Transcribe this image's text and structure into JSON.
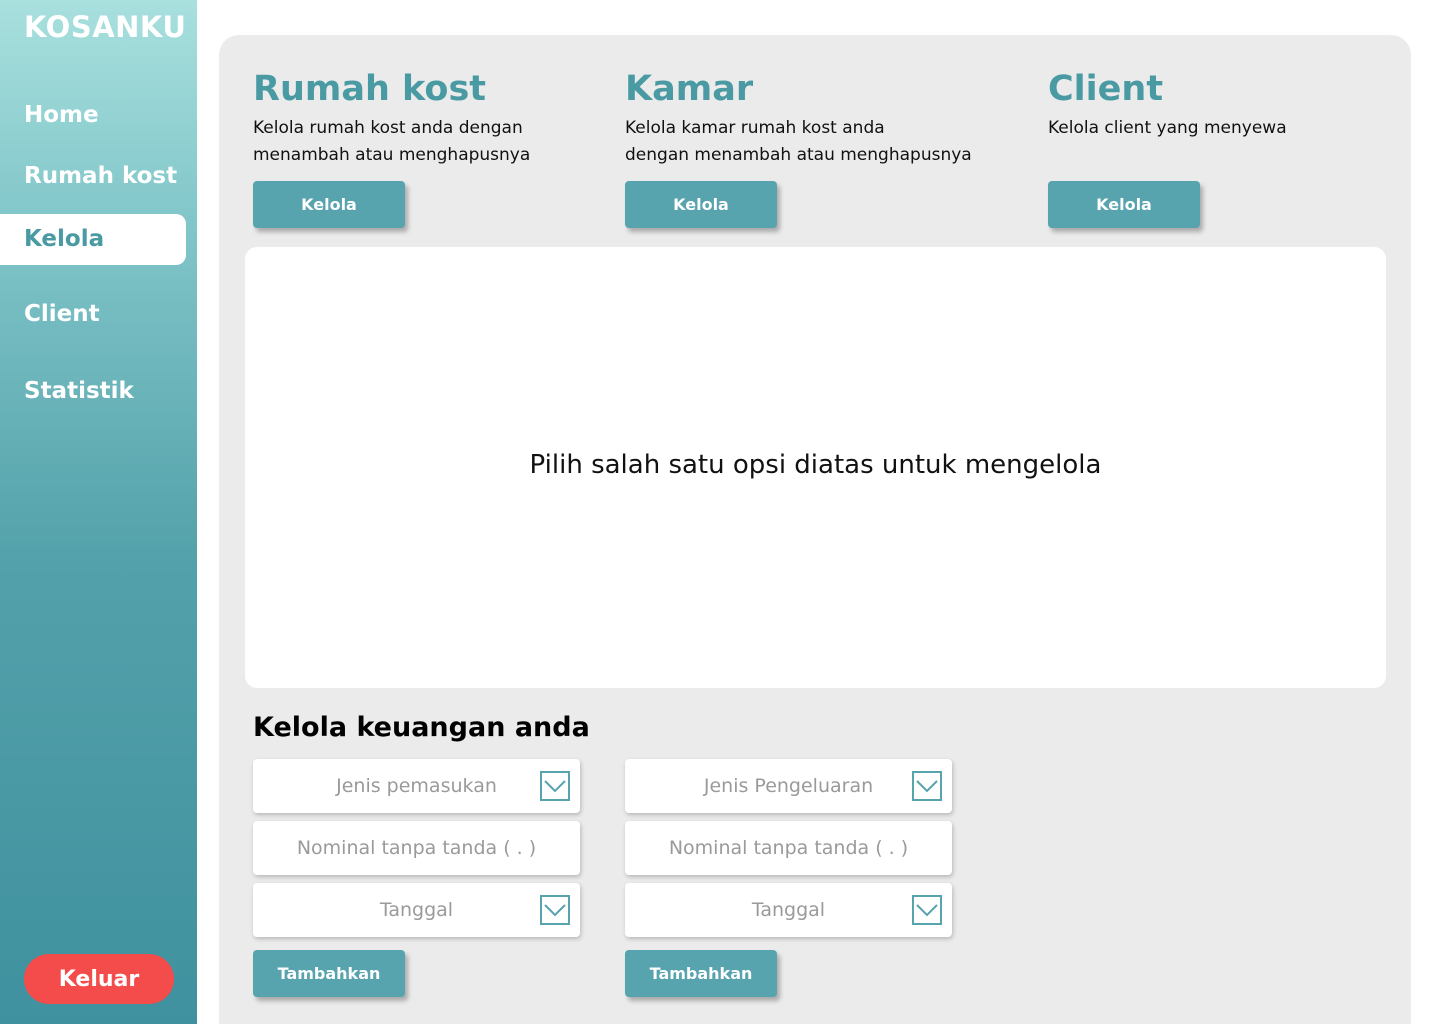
{
  "app": {
    "brand": "KOSANKU"
  },
  "sidebar": {
    "items": [
      {
        "label": "Home"
      },
      {
        "label": "Rumah kost"
      },
      {
        "label": "Kelola"
      },
      {
        "label": "Client"
      },
      {
        "label": "Statistik"
      }
    ],
    "active": "Kelola",
    "logout_label": "Keluar"
  },
  "cards": [
    {
      "title": "Rumah kost",
      "desc_line1": "Kelola rumah kost anda dengan",
      "desc_line2": "menambah atau menghapusnya",
      "button": "Kelola"
    },
    {
      "title": "Kamar",
      "desc_line1": "Kelola kamar rumah kost anda",
      "desc_line2": "dengan menambah atau menghapusnya",
      "button": "Kelola"
    },
    {
      "title": "Client",
      "desc_line1": "Kelola client  yang menyewa",
      "desc_line2": "",
      "button": "Kelola"
    }
  ],
  "main": {
    "message": "Pilih salah satu opsi diatas untuk mengelola"
  },
  "finance": {
    "title": "Kelola keuangan anda",
    "income": {
      "type_placeholder": "Jenis pemasukan",
      "amount_placeholder": "Nominal tanpa tanda  ( . )",
      "date_placeholder": "Tanggal",
      "submit_label": "Tambahkan"
    },
    "expense": {
      "type_placeholder": "Jenis Pengeluaran",
      "amount_placeholder": "Nominal tanpa tanda  ( . )",
      "date_placeholder": "Tanggal",
      "submit_label": "Tambahkan"
    }
  },
  "colors": {
    "accent": "#4a9aa3",
    "button": "#57a3ae",
    "logout": "#f44b4b",
    "panel": "#ebebeb"
  }
}
